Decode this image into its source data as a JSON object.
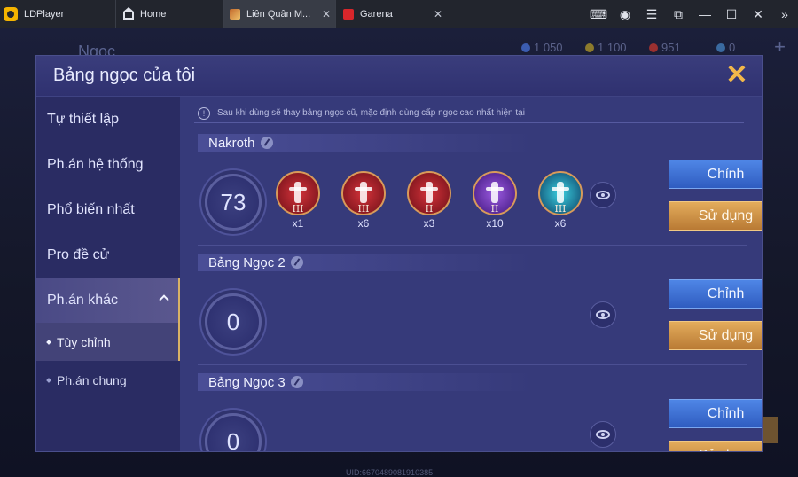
{
  "emulator": {
    "brand": "LDPlayer",
    "tabs": [
      {
        "label": "Home"
      },
      {
        "label": "Liên Quân M..."
      },
      {
        "label": "Garena"
      }
    ],
    "controls": [
      "gamepad-icon",
      "user-icon",
      "menu-icon",
      "restore-icon",
      "minimize-icon",
      "maximize-icon",
      "close-icon",
      "collapse-icon"
    ]
  },
  "background": {
    "title": "Ngọc",
    "resources": [
      "1 050",
      "1 100",
      "951",
      "0"
    ],
    "uid": "UID:6670489081910385"
  },
  "modal": {
    "title": "Bảng ngọc của tôi",
    "notice": "Sau khi dùng sẽ thay bảng ngọc cũ, mặc định dùng cấp ngọc cao nhất hiện tại",
    "sidebar": {
      "items": [
        {
          "label": "Tự thiết lập"
        },
        {
          "label": "Ph.án hệ thống"
        },
        {
          "label": "Phổ biến nhất"
        },
        {
          "label": "Pro đề cử"
        },
        {
          "label": "Ph.án khác"
        }
      ],
      "sub_items": [
        {
          "label": "Tùy chỉnh"
        },
        {
          "label": "Ph.án chung"
        }
      ]
    },
    "pages": [
      {
        "name": "Nakroth",
        "level": "73",
        "edit_label": "Chỉnh",
        "use_label": "Sử dụng",
        "runes": [
          {
            "color": "red",
            "tier": "III",
            "count": "x1"
          },
          {
            "color": "red",
            "tier": "III",
            "count": "x6"
          },
          {
            "color": "red",
            "tier": "II",
            "count": "x3"
          },
          {
            "color": "purple",
            "tier": "II",
            "count": "x10"
          },
          {
            "color": "cyan",
            "tier": "III",
            "count": "x6"
          }
        ]
      },
      {
        "name": "Bảng Ngọc 2",
        "level": "0",
        "edit_label": "Chỉnh",
        "use_label": "Sử dụng"
      },
      {
        "name": "Bảng Ngọc 3",
        "level": "0",
        "edit_label": "Chỉnh",
        "use_label": "Sử dụng"
      }
    ]
  }
}
